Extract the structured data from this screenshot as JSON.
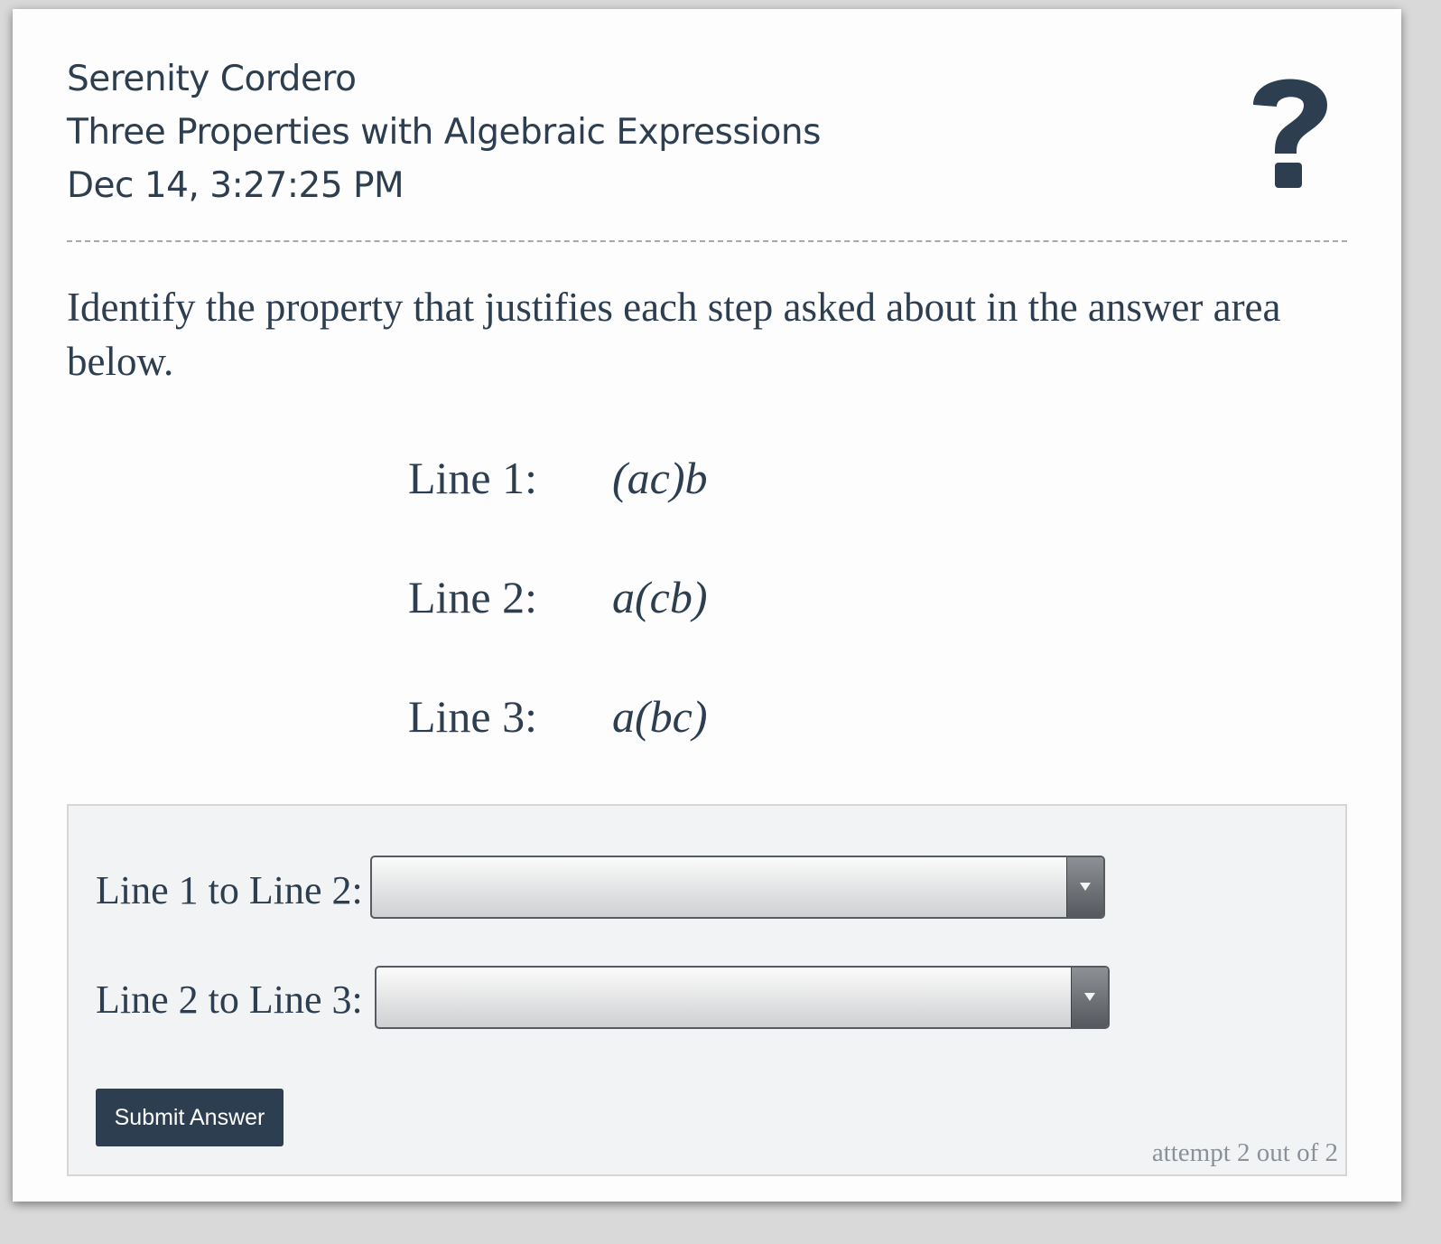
{
  "header": {
    "student_name": "Serenity Cordero",
    "assignment_title": "Three Properties with Algebraic Expressions",
    "timestamp": "Dec 14, 3:27:25 PM",
    "help_icon": "question-mark-icon"
  },
  "question": {
    "prompt": "Identify the property that justifies each step asked about in the answer area below.",
    "lines": [
      {
        "label": "Line 1:",
        "expression": "(ac)b"
      },
      {
        "label": "Line 2:",
        "expression": "a(cb)"
      },
      {
        "label": "Line 3:",
        "expression": "a(bc)"
      }
    ]
  },
  "answer": {
    "rows": [
      {
        "label": "Line 1 to Line 2:",
        "selected": ""
      },
      {
        "label": "Line 2 to Line 3:",
        "selected": ""
      }
    ],
    "submit_label": "Submit Answer",
    "attempt_text": "attempt 2 out of 2"
  },
  "colors": {
    "primary": "#2d3e50",
    "answer_bg": "#f2f3f4",
    "muted_text": "#8a9199"
  }
}
